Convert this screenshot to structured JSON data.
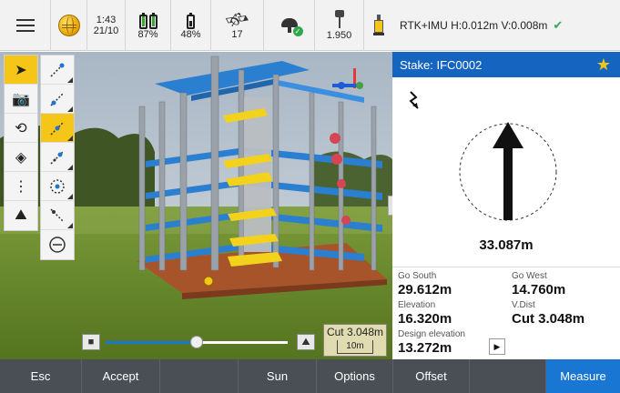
{
  "status_bar": {
    "menu_icon": "hamburger-menu-icon",
    "globe_icon": "globe-icon",
    "time": "1:43",
    "date": "21/10",
    "controller_battery": "87%",
    "receiver_battery": "48%",
    "satellites": "17",
    "antenna_height": "1.950"
  },
  "rtk_status": "RTK+IMU H:0.012m V:0.008m",
  "stake": {
    "title": "Stake: IFC0002",
    "distance": "33.087m"
  },
  "values": {
    "go_south_label": "Go South",
    "go_south_value": "29.612m",
    "go_west_label": "Go West",
    "go_west_value": "14.760m",
    "elevation_label": "Elevation",
    "elevation_value": "16.320m",
    "vdist_label": "V.Dist",
    "vdist_value": "Cut 3.048m",
    "design_elevation_label": "Design elevation",
    "design_elevation_value": "13.272m",
    "more_glyph": "▶"
  },
  "scene": {
    "cut_label": "Cut 3.048m",
    "scale_label": "10m",
    "slider_level": 0.5
  },
  "bottom_bar": {
    "esc": "Esc",
    "accept": "Accept",
    "blank1": "",
    "sun": "Sun",
    "options": "Options",
    "offset": "Offset",
    "blank2": "",
    "measure": "Measure"
  },
  "colors": {
    "accent": "#1976d2",
    "header_blue": "#1565c0",
    "highlight": "#f5c518",
    "ok_green": "#2fa84f",
    "bottom_bar": "#4a4f56"
  }
}
